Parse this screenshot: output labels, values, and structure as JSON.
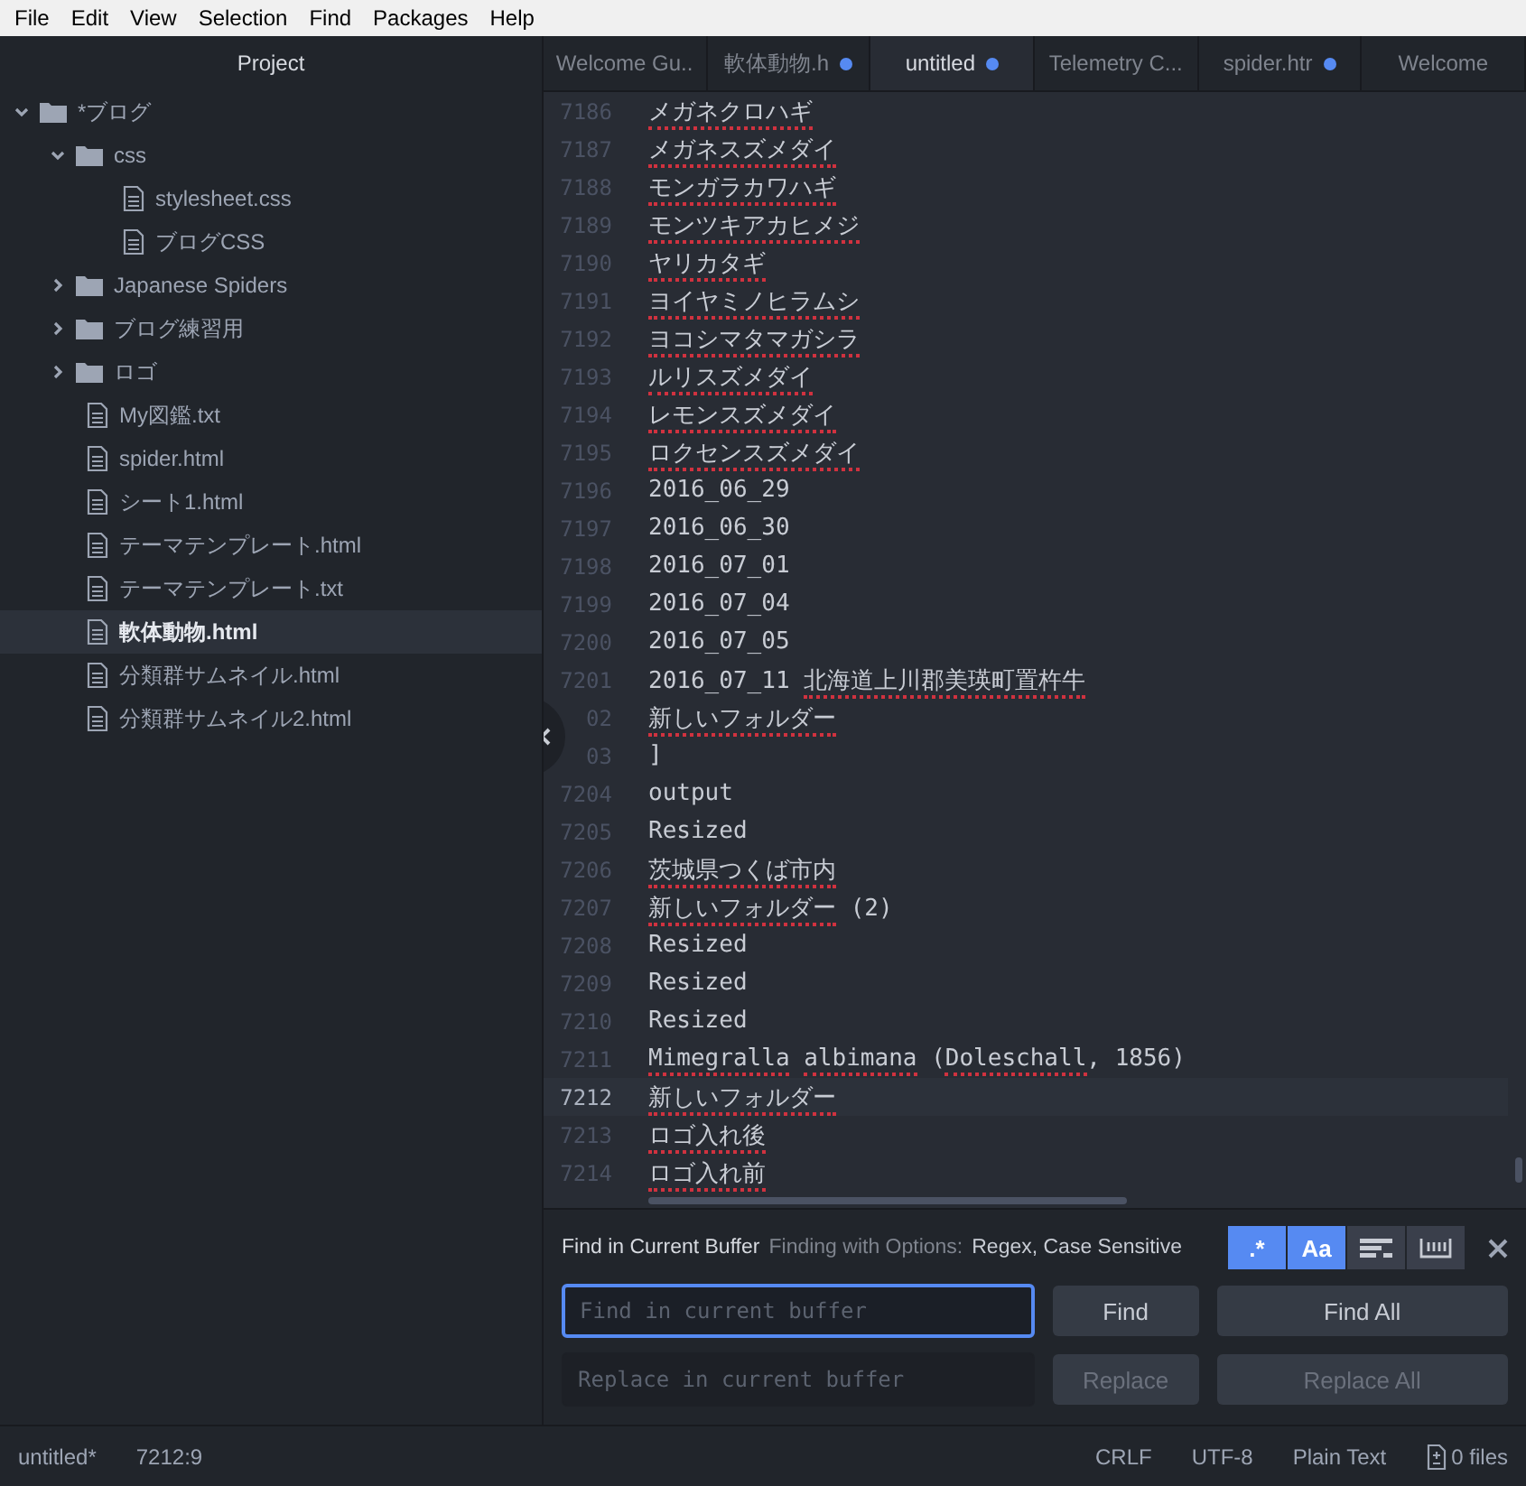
{
  "menu": [
    "File",
    "Edit",
    "View",
    "Selection",
    "Find",
    "Packages",
    "Help"
  ],
  "sidebar": {
    "title": "Project",
    "tree": [
      {
        "kind": "folder",
        "name": "*ブログ",
        "expanded": true,
        "selected": false,
        "children": [
          {
            "kind": "folder",
            "name": "css",
            "expanded": true,
            "selected": false,
            "children": [
              {
                "kind": "file",
                "name": "stylesheet.css",
                "selected": false
              },
              {
                "kind": "file",
                "name": "ブログCSS",
                "selected": false
              }
            ]
          },
          {
            "kind": "folder",
            "name": "Japanese Spiders",
            "expanded": false,
            "selected": false
          },
          {
            "kind": "folder",
            "name": "ブログ練習用",
            "expanded": false,
            "selected": false
          },
          {
            "kind": "folder",
            "name": "ロゴ",
            "expanded": false,
            "selected": false
          },
          {
            "kind": "file",
            "name": "My図鑑.txt",
            "selected": false
          },
          {
            "kind": "file",
            "name": "spider.html",
            "selected": false
          },
          {
            "kind": "file",
            "name": "シート1.html",
            "selected": false
          },
          {
            "kind": "file",
            "name": "テーマテンプレート.html",
            "selected": false
          },
          {
            "kind": "file",
            "name": "テーマテンプレート.txt",
            "selected": false
          },
          {
            "kind": "file",
            "name": "軟体動物.html",
            "selected": true
          },
          {
            "kind": "file",
            "name": "分類群サムネイル.html",
            "selected": false
          },
          {
            "kind": "file",
            "name": "分類群サムネイル2.html",
            "selected": false
          }
        ]
      }
    ]
  },
  "tabs": [
    {
      "title": "Welcome Gu..",
      "modified": false,
      "selected": false
    },
    {
      "title": "軟体動物.h",
      "modified": true,
      "selected": false
    },
    {
      "title": "untitled",
      "modified": true,
      "selected": true
    },
    {
      "title": "Telemetry C...",
      "modified": false,
      "selected": false
    },
    {
      "title": "spider.htr",
      "modified": true,
      "selected": false
    },
    {
      "title": "Welcome",
      "modified": false,
      "selected": false
    }
  ],
  "editor": {
    "lines": [
      {
        "number": "7186",
        "current": false,
        "segments": [
          {
            "text": "メガネクロハギ",
            "misspelled": true
          }
        ]
      },
      {
        "number": "7187",
        "current": false,
        "segments": [
          {
            "text": "メガネスズメダイ",
            "misspelled": true
          }
        ]
      },
      {
        "number": "7188",
        "current": false,
        "segments": [
          {
            "text": "モンガラカワハギ",
            "misspelled": true
          }
        ]
      },
      {
        "number": "7189",
        "current": false,
        "segments": [
          {
            "text": "モンツキアカヒメジ",
            "misspelled": true
          }
        ]
      },
      {
        "number": "7190",
        "current": false,
        "segments": [
          {
            "text": "ヤリカタギ",
            "misspelled": true
          }
        ]
      },
      {
        "number": "7191",
        "current": false,
        "segments": [
          {
            "text": "ヨイヤミノヒラムシ",
            "misspelled": true
          }
        ]
      },
      {
        "number": "7192",
        "current": false,
        "segments": [
          {
            "text": "ヨコシマタマガシラ",
            "misspelled": true
          }
        ]
      },
      {
        "number": "7193",
        "current": false,
        "segments": [
          {
            "text": "ルリスズメダイ",
            "misspelled": true
          }
        ]
      },
      {
        "number": "7194",
        "current": false,
        "segments": [
          {
            "text": "レモンスズメダイ",
            "misspelled": true
          }
        ]
      },
      {
        "number": "7195",
        "current": false,
        "segments": [
          {
            "text": "ロクセンスズメダイ",
            "misspelled": true
          }
        ]
      },
      {
        "number": "7196",
        "current": false,
        "segments": [
          {
            "text": "2016_06_29",
            "misspelled": false
          }
        ]
      },
      {
        "number": "7197",
        "current": false,
        "segments": [
          {
            "text": "2016_06_30",
            "misspelled": false
          }
        ]
      },
      {
        "number": "7198",
        "current": false,
        "segments": [
          {
            "text": "2016_07_01",
            "misspelled": false
          }
        ]
      },
      {
        "number": "7199",
        "current": false,
        "segments": [
          {
            "text": "2016_07_04",
            "misspelled": false
          }
        ]
      },
      {
        "number": "7200",
        "current": false,
        "segments": [
          {
            "text": "2016_07_05",
            "misspelled": false
          }
        ]
      },
      {
        "number": "7201",
        "current": false,
        "segments": [
          {
            "text": "2016_07_11 ",
            "misspelled": false
          },
          {
            "text": "北海道上川郡美瑛町置杵牛",
            "misspelled": true
          }
        ]
      },
      {
        "number": "02",
        "current": false,
        "segments": [
          {
            "text": "新しいフォルダー",
            "misspelled": true
          }
        ]
      },
      {
        "number": "03",
        "current": false,
        "segments": [
          {
            "text": "]",
            "misspelled": false
          }
        ]
      },
      {
        "number": "7204",
        "current": false,
        "segments": [
          {
            "text": "output",
            "misspelled": false
          }
        ]
      },
      {
        "number": "7205",
        "current": false,
        "segments": [
          {
            "text": "Resized",
            "misspelled": false
          }
        ]
      },
      {
        "number": "7206",
        "current": false,
        "segments": [
          {
            "text": "茨城県つくば市内",
            "misspelled": true
          }
        ]
      },
      {
        "number": "7207",
        "current": false,
        "segments": [
          {
            "text": "新しいフォルダー",
            "misspelled": true
          },
          {
            "text": " (2)",
            "misspelled": false
          }
        ]
      },
      {
        "number": "7208",
        "current": false,
        "segments": [
          {
            "text": "Resized",
            "misspelled": false
          }
        ]
      },
      {
        "number": "7209",
        "current": false,
        "segments": [
          {
            "text": "Resized",
            "misspelled": false
          }
        ]
      },
      {
        "number": "7210",
        "current": false,
        "segments": [
          {
            "text": "Resized",
            "misspelled": false
          }
        ]
      },
      {
        "number": "7211",
        "current": false,
        "segments": [
          {
            "text": "Mimegralla",
            "misspelled": true
          },
          {
            "text": " albimana",
            "misspelled": true
          },
          {
            "text": " (",
            "misspelled": false
          },
          {
            "text": "Doleschall",
            "misspelled": true
          },
          {
            "text": ", 1856)",
            "misspelled": false
          }
        ]
      },
      {
        "number": "7212",
        "current": true,
        "segments": [
          {
            "text": "新しいフォルダー",
            "misspelled": true
          }
        ]
      },
      {
        "number": "7213",
        "current": false,
        "segments": [
          {
            "text": "ロゴ入れ後",
            "misspelled": true
          }
        ]
      },
      {
        "number": "7214",
        "current": false,
        "segments": [
          {
            "text": "ロゴ入れ前",
            "misspelled": true
          }
        ]
      }
    ]
  },
  "find_panel": {
    "title": "Find in Current Buffer",
    "options_label": "Finding with Options:",
    "options_value": "Regex, Case Sensitive",
    "toggles": [
      {
        "kind": "regex",
        "label": ".*",
        "selected": true
      },
      {
        "kind": "case",
        "label": "Aa",
        "selected": true
      },
      {
        "kind": "selection",
        "selected": false
      },
      {
        "kind": "word",
        "selected": false
      }
    ],
    "find_field": {
      "placeholder": "Find in current buffer",
      "focused": true
    },
    "replace_field": {
      "placeholder": "Replace in current buffer",
      "focused": false
    },
    "find_buttons": [
      {
        "label": "Find",
        "disabled": false
      },
      {
        "label": "Find All",
        "disabled": false
      }
    ],
    "replace_buttons": [
      {
        "label": "Replace",
        "disabled": true
      },
      {
        "label": "Replace All",
        "disabled": true
      }
    ]
  },
  "status_bar": {
    "file": "untitled*",
    "cursor": "7212:9",
    "line_ending": "CRLF",
    "encoding": "UTF-8",
    "grammar": "Plain Text",
    "git": "0 files"
  }
}
